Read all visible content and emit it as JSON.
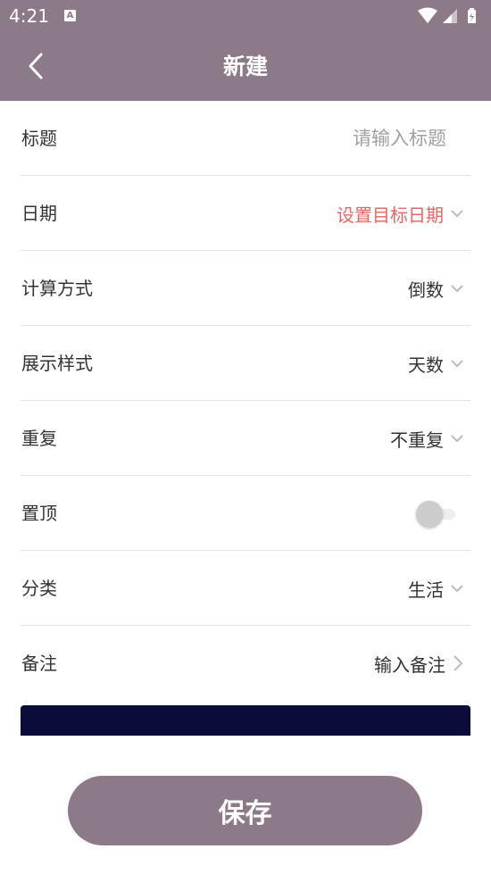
{
  "status_bar": {
    "time": "4:21",
    "notif_icon": "a-icon"
  },
  "app_bar": {
    "title": "新建",
    "back_icon": "chevron-left-icon"
  },
  "theme": {
    "primary": "#8c7a88",
    "accent_red": "#e56666",
    "banner": "#0a0d3a"
  },
  "form": {
    "title": {
      "label": "标题",
      "placeholder": "请输入标题",
      "value": ""
    },
    "date": {
      "label": "日期",
      "value": "设置目标日期"
    },
    "calc_mode": {
      "label": "计算方式",
      "value": "倒数"
    },
    "display_style": {
      "label": "展示样式",
      "value": "天数"
    },
    "repeat": {
      "label": "重复",
      "value": "不重复"
    },
    "pin_top": {
      "label": "置顶",
      "on": false
    },
    "category": {
      "label": "分类",
      "value": "生活"
    },
    "note": {
      "label": "备注",
      "value": "输入备注"
    }
  },
  "save_button": {
    "label": "保存"
  }
}
